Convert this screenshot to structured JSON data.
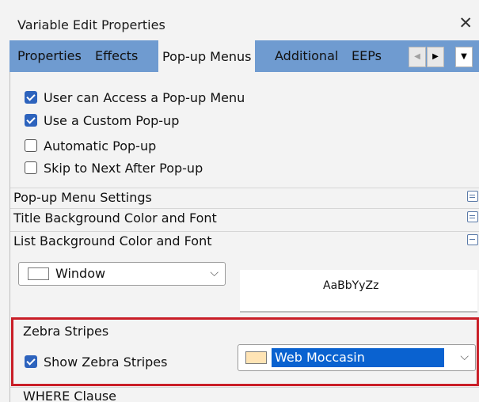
{
  "window": {
    "title": "Variable Edit Properties",
    "close_symbol": "✕"
  },
  "tabs": [
    {
      "label": "Properties"
    },
    {
      "label": "Effects"
    },
    {
      "label": "Pop-up Menus",
      "active": true
    },
    {
      "label": "Additional"
    },
    {
      "label": "EEPs"
    }
  ],
  "tab_nav": {
    "left_symbol": "◀",
    "right_symbol": "▶",
    "menu_symbol": "▼"
  },
  "options": [
    {
      "label": "User can Access a Pop-up Menu",
      "checked": true
    },
    {
      "label": "Use a Custom Pop-up",
      "checked": true
    },
    {
      "label": "Automatic Pop-up",
      "checked": false
    },
    {
      "label": "Skip to Next After Pop-up",
      "checked": false
    }
  ],
  "sections": {
    "popup_menu_settings": "Pop-up Menu Settings",
    "title_background": "Title Background Color and Font",
    "list_background": "List Background Color and Font",
    "zebra_stripes": "Zebra Stripes",
    "where_clause": "WHERE Clause"
  },
  "list_color": {
    "value": "Window",
    "swatch": "#ffffff"
  },
  "font_preview": "AaBbYyZz",
  "zebra": {
    "show_label": "Show Zebra Stripes",
    "checked": true,
    "color_value": "Web Moccasin",
    "swatch": "#ffe4b5"
  },
  "colors": {
    "accent": "#2d63bd",
    "tab_bar": "#6f9bd0",
    "highlight": "#c91e27"
  }
}
